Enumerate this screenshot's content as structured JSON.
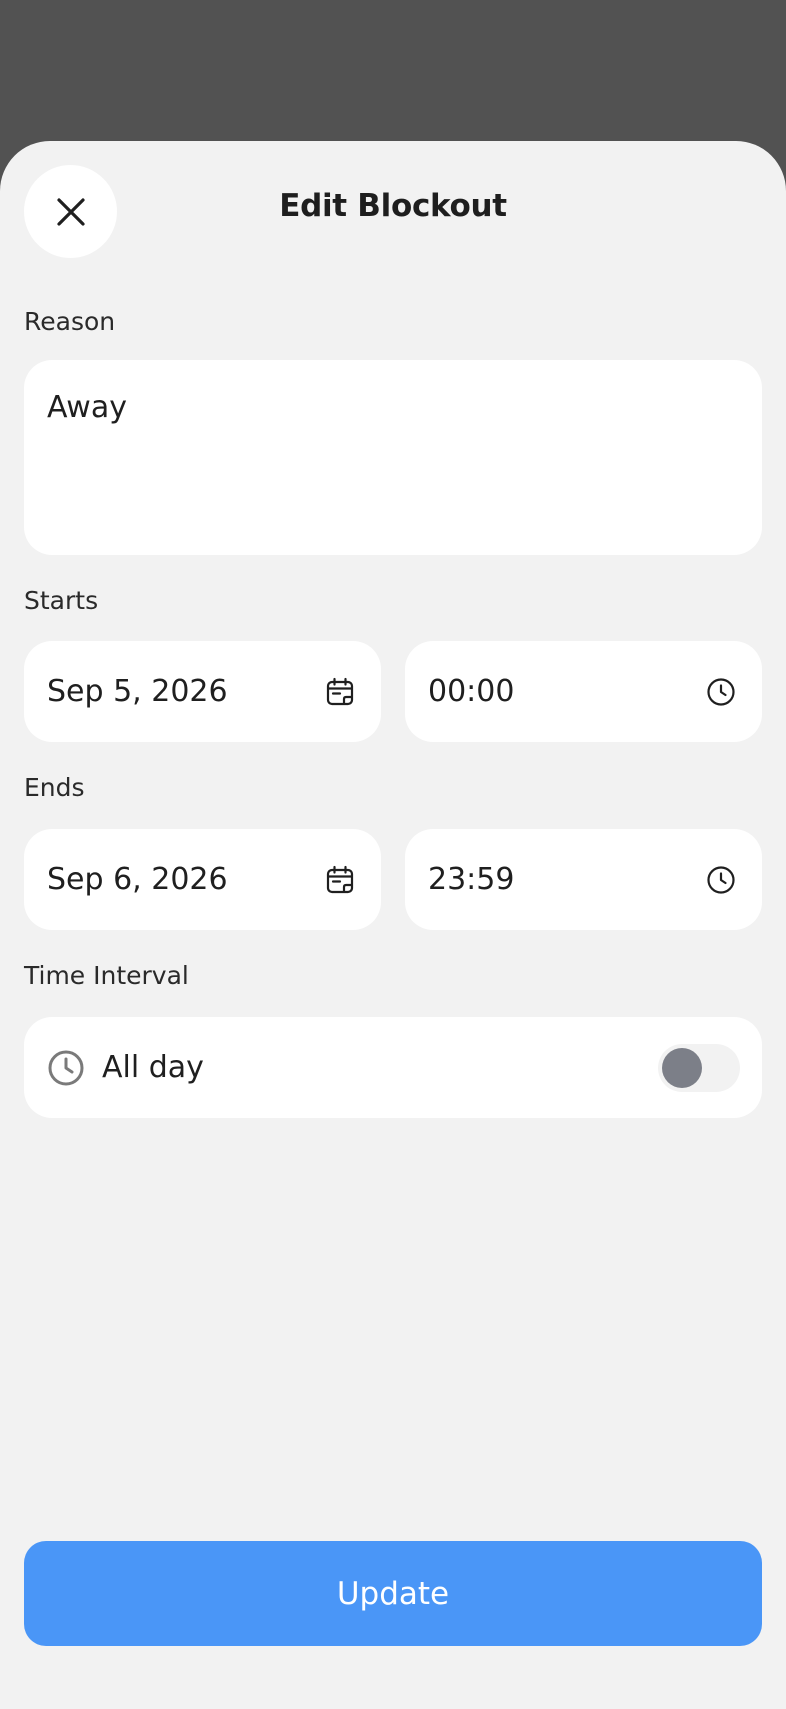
{
  "header": {
    "title": "Edit Blockout",
    "close_icon": "close-icon"
  },
  "reason": {
    "label": "Reason",
    "value": "Away"
  },
  "starts": {
    "label": "Starts",
    "date": "Sep 5, 2026",
    "time": "00:00",
    "date_icon": "calendar-icon",
    "time_icon": "clock-icon"
  },
  "ends": {
    "label": "Ends",
    "date": "Sep 6, 2026",
    "time": "23:59",
    "date_icon": "calendar-icon",
    "time_icon": "clock-icon"
  },
  "time_interval": {
    "label": "Time Interval",
    "all_day_label": "All day",
    "all_day_enabled": false,
    "icon": "clock-icon"
  },
  "actions": {
    "update_label": "Update"
  },
  "colors": {
    "backdrop": "#525252",
    "sheet": "#f2f2f2",
    "card": "#ffffff",
    "accent": "#4a96f7",
    "toggle_knob_off": "#7c7f88"
  }
}
